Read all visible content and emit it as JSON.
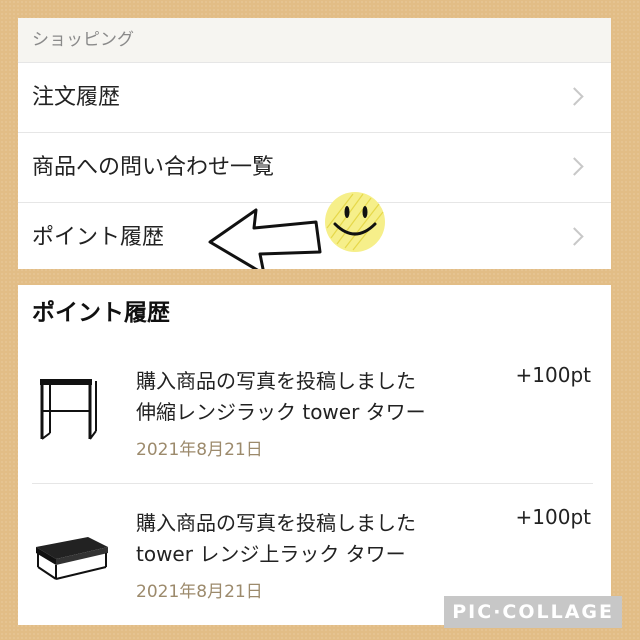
{
  "shopping": {
    "header": "ショッピング",
    "items": [
      {
        "label": "注文履歴"
      },
      {
        "label": "商品への問い合わせ一覧"
      },
      {
        "label": "ポイント履歴"
      }
    ]
  },
  "point_history": {
    "title": "ポイント履歴",
    "entries": [
      {
        "line1": "購入商品の写真を投稿しました",
        "line2": "伸縮レンジラック tower タワー",
        "date": "2021年8月21日",
        "points": "+100pt"
      },
      {
        "line1": "購入商品の写真を投稿しました",
        "line2": "tower レンジ上ラック タワー",
        "date": "2021年8月21日",
        "points": "+100pt"
      }
    ]
  },
  "watermark": "PIC·COLLAGE",
  "colors": {
    "background": "#e2bd86",
    "card": "#ffffff",
    "date_text": "#9c8a6c",
    "section_header_bg": "#f6f5f1"
  }
}
